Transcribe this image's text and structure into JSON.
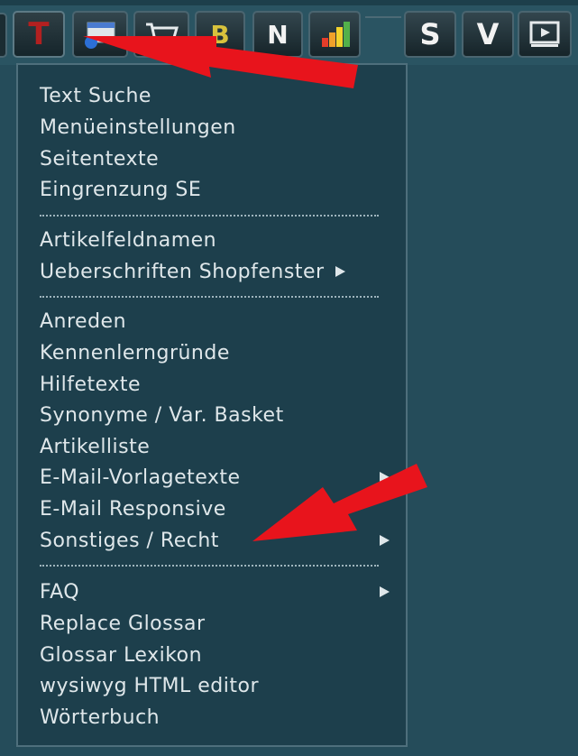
{
  "toolbar": {
    "buttons": [
      {
        "name": "text-button",
        "label": "T"
      },
      {
        "name": "window-button",
        "label": ""
      },
      {
        "name": "cart-button",
        "label": ""
      },
      {
        "name": "b-button",
        "label": "B"
      },
      {
        "name": "n-button",
        "label": "N"
      },
      {
        "name": "chart-button",
        "label": ""
      },
      {
        "name": "s-button",
        "label": "S"
      },
      {
        "name": "v-button",
        "label": "V"
      },
      {
        "name": "video-button",
        "label": ""
      }
    ]
  },
  "menu": {
    "groups": [
      {
        "items": [
          {
            "label": "Text Suche",
            "submenu": false
          },
          {
            "label": "Menüeinstellungen",
            "submenu": false
          },
          {
            "label": "Seitentexte",
            "submenu": false
          },
          {
            "label": "Eingrenzung SE",
            "submenu": false
          }
        ]
      },
      {
        "items": [
          {
            "label": "Artikelfeldnamen",
            "submenu": false
          },
          {
            "label": "Ueberschriften Shopfenster",
            "submenu": true
          }
        ]
      },
      {
        "items": [
          {
            "label": "Anreden",
            "submenu": false
          },
          {
            "label": "Kennenlerngründe",
            "submenu": false
          },
          {
            "label": "Hilfetexte",
            "submenu": false
          },
          {
            "label": "Synonyme / Var. Basket",
            "submenu": false
          },
          {
            "label": "Artikelliste",
            "submenu": false
          },
          {
            "label": "E-Mail-Vorlagetexte",
            "submenu": true
          },
          {
            "label": "E-Mail Responsive",
            "submenu": false
          },
          {
            "label": "Sonstiges / Recht",
            "submenu": true
          }
        ]
      },
      {
        "items": [
          {
            "label": "FAQ",
            "submenu": true
          },
          {
            "label": "Replace Glossar",
            "submenu": false
          },
          {
            "label": "Glossar Lexikon",
            "submenu": false
          },
          {
            "label": "wysiwyg HTML editor",
            "submenu": false
          },
          {
            "label": "Wörterbuch",
            "submenu": false
          }
        ]
      }
    ]
  },
  "colors": {
    "background": "#254c5a",
    "menu_bg": "#1d3f4c",
    "menu_text": "#dfe7ea",
    "annotation_arrow": "#e8141c",
    "t_icon": "#b22020",
    "b_icon": "#d8c23c"
  }
}
